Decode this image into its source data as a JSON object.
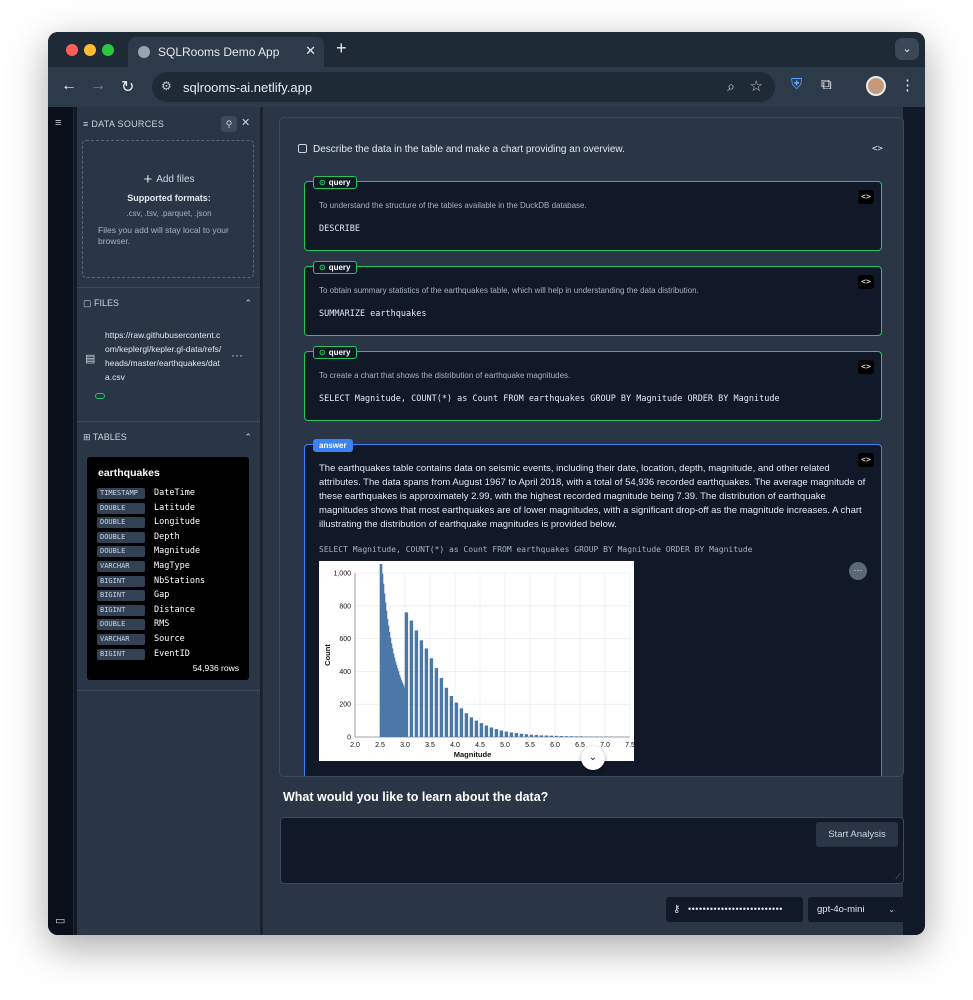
{
  "browser": {
    "tab_title": "SQLRooms Demo App",
    "tab_close": "✕",
    "new_tab": "+",
    "url": "sqlrooms-ai.netlify.app"
  },
  "sidebar": {
    "data_sources_label": "DATA SOURCES",
    "add_files_label": "Add files",
    "supported_formats_label": "Supported formats:",
    "formats": ".csv, .tsv, .parquet, .json",
    "local_note": "Files you add will stay local to your browser.",
    "files_label": "FILES",
    "file_url": "https://raw.githubusercontent.com/keplergl/kepler.gl-data/refs/heads/master/earthquakes/data.csv",
    "tables_label": "TABLES",
    "table": {
      "name": "earthquakes",
      "columns": [
        {
          "type": "TIMESTAMP",
          "name": "DateTime"
        },
        {
          "type": "DOUBLE",
          "name": "Latitude"
        },
        {
          "type": "DOUBLE",
          "name": "Longitude"
        },
        {
          "type": "DOUBLE",
          "name": "Depth"
        },
        {
          "type": "DOUBLE",
          "name": "Magnitude"
        },
        {
          "type": "VARCHAR",
          "name": "MagType"
        },
        {
          "type": "BIGINT",
          "name": "NbStations"
        },
        {
          "type": "BIGINT",
          "name": "Gap"
        },
        {
          "type": "BIGINT",
          "name": "Distance"
        },
        {
          "type": "DOUBLE",
          "name": "RMS"
        },
        {
          "type": "VARCHAR",
          "name": "Source"
        },
        {
          "type": "BIGINT",
          "name": "EventID"
        }
      ],
      "row_count": "54,936 rows"
    }
  },
  "chat": {
    "prompt": "Describe the data in the table and make a chart providing an overview.",
    "code_toggle": "<>",
    "queries": [
      {
        "badge": "query",
        "description": "To understand the structure of the tables available in the DuckDB database.",
        "sql": "DESCRIBE"
      },
      {
        "badge": "query",
        "description": "To obtain summary statistics of the earthquakes table, which will help in understanding the data distribution.",
        "sql": "SUMMARIZE earthquakes"
      },
      {
        "badge": "query",
        "description": "To create a chart that shows the distribution of earthquake magnitudes.",
        "sql": "SELECT Magnitude, COUNT(*) as Count FROM earthquakes GROUP BY Magnitude ORDER BY Magnitude"
      }
    ],
    "answer": {
      "badge": "answer",
      "text": "The earthquakes table contains data on seismic events, including their date, location, depth, magnitude, and other related attributes. The data spans from August 1967 to April 2018, with a total of 54,936 recorded earthquakes. The average magnitude of these earthquakes is approximately 2.99, with the highest recorded magnitude being 7.39. The distribution of earthquake magnitudes shows that most earthquakes are of lower magnitudes, with a significant drop-off as the magnitude increases. A chart illustrating the distribution of earthquake magnitudes is provided below.",
      "sql": "SELECT Magnitude, COUNT(*) as Count FROM earthquakes GROUP BY Magnitude ORDER BY Magnitude"
    },
    "learn_heading": "What would you like to learn about the data?",
    "input_value": "",
    "start_button": "Start Analysis",
    "api_key_mask": "••••••••••••••••••••••••••",
    "model": "gpt-4o-mini"
  },
  "chart_data": {
    "type": "bar",
    "xlabel": "Magnitude",
    "ylabel": "Count",
    "xlim": [
      2.0,
      7.5
    ],
    "ylim": [
      0,
      1000
    ],
    "x_ticks": [
      "2.0",
      "2.5",
      "3.0",
      "3.5",
      "4.0",
      "4.5",
      "5.0",
      "5.5",
      "6.0",
      "6.5",
      "7.0",
      "7.5"
    ],
    "y_ticks": [
      "0",
      "200",
      "400",
      "600",
      "800",
      "1,000"
    ],
    "color": "#4c78a8",
    "x": [
      2.5,
      2.52,
      2.54,
      2.56,
      2.58,
      2.6,
      2.62,
      2.64,
      2.66,
      2.68,
      2.7,
      2.72,
      2.74,
      2.76,
      2.78,
      2.8,
      2.82,
      2.84,
      2.86,
      2.88,
      2.9,
      2.92,
      2.94,
      2.96,
      2.98,
      3.0,
      3.1,
      3.2,
      3.3,
      3.4,
      3.5,
      3.6,
      3.7,
      3.8,
      3.9,
      4.0,
      4.1,
      4.2,
      4.3,
      4.4,
      4.5,
      4.6,
      4.7,
      4.8,
      4.9,
      5.0,
      5.1,
      5.2,
      5.3,
      5.4,
      5.5,
      5.6,
      5.7,
      5.8,
      5.9,
      6.0,
      6.1,
      6.2,
      6.3,
      6.4,
      6.5,
      6.6,
      6.7,
      6.8,
      6.9,
      7.0,
      7.1,
      7.2,
      7.3,
      7.39
    ],
    "values": [
      1055,
      995,
      935,
      875,
      820,
      770,
      720,
      680,
      640,
      605,
      570,
      540,
      510,
      485,
      460,
      440,
      420,
      400,
      380,
      362,
      345,
      330,
      315,
      300,
      290,
      760,
      710,
      650,
      590,
      540,
      480,
      420,
      360,
      300,
      250,
      210,
      175,
      145,
      120,
      100,
      85,
      70,
      58,
      48,
      40,
      33,
      28,
      24,
      20,
      17,
      14,
      12,
      10,
      9,
      8,
      7,
      6,
      5,
      5,
      4,
      4,
      3,
      3,
      3,
      2,
      2,
      2,
      1,
      1,
      1
    ]
  }
}
